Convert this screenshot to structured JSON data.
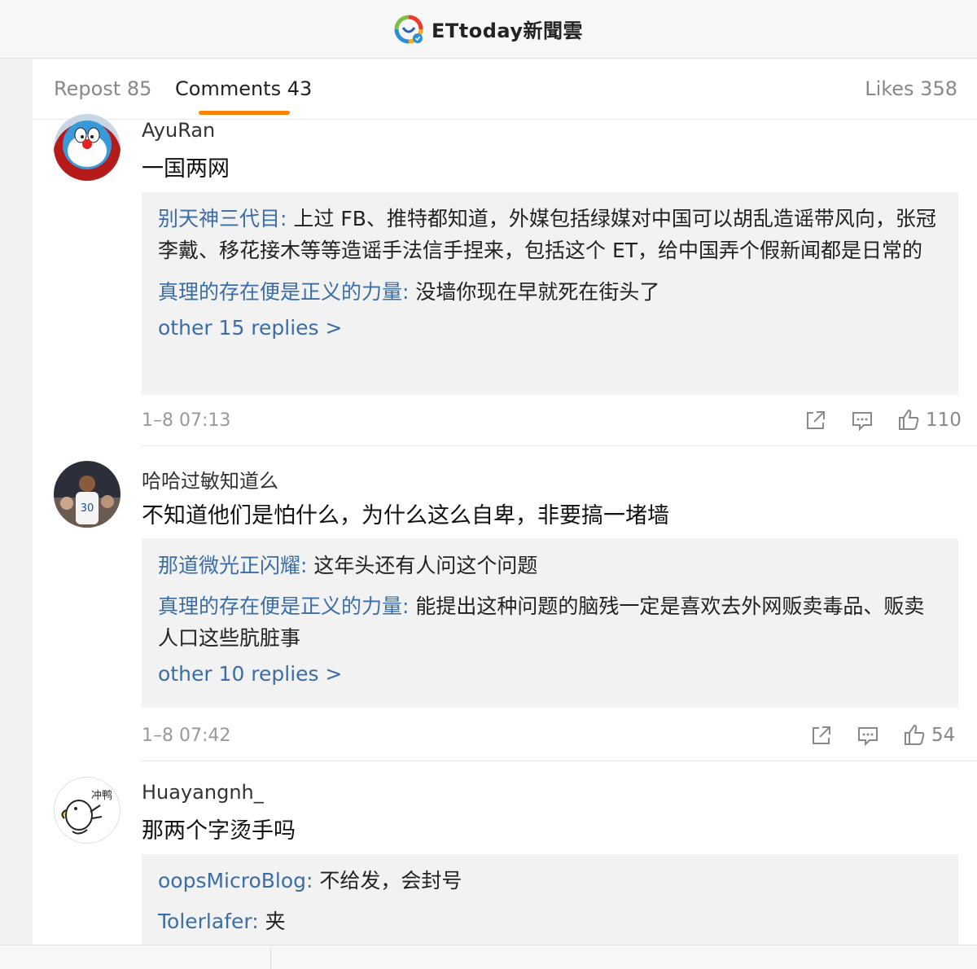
{
  "header": {
    "brand": "ETtoday新聞雲",
    "logo_icon": "ettoday-logo-icon",
    "verified_icon": "verified-badge-icon"
  },
  "tabs": {
    "repost": "Repost 85",
    "comments": "Comments 43",
    "likes": "Likes 358",
    "active": "comments",
    "accent_color": "#ff8200"
  },
  "comments": [
    {
      "user": "AyuRan",
      "avatar_icon": "doraemon-avatar",
      "text": "一国两网",
      "replies": [
        {
          "user": "别天神三代目",
          "sep": ": ",
          "text": "上过 FB、推特都知道，外媒包括绿媒对中国可以胡乱造谣带风向，张冠李戴、移花接木等等造谣手法信手捏来，包括这个 ET，给中国弄个假新闻都是日常的"
        },
        {
          "user": "真理的存在便是正义的力量",
          "sep": ": ",
          "text": "没墙你现在早就死在街头了"
        }
      ],
      "more": "other 15 replies >",
      "time": "1–8 07:13",
      "likes": "110"
    },
    {
      "user": "哈哈过敏知道么",
      "avatar_icon": "basketball-player-avatar",
      "text": "不知道他们是怕什么，为什么这么自卑，非要搞一堵墙",
      "replies": [
        {
          "user": "那道微光正闪耀",
          "sep": ": ",
          "text": "这年头还有人问这个问题"
        },
        {
          "user": "真理的存在便是正义的力量",
          "sep": ": ",
          "text": "能提出这种问题的脑残一定是喜欢去外网贩卖毒品、贩卖人口这些肮脏事"
        }
      ],
      "more": "other 10 replies >",
      "time": "1–8 07:42",
      "likes": "54"
    },
    {
      "user": "Huayangnh_",
      "avatar_icon": "duck-cartoon-avatar",
      "avatar_text": "冲鸭",
      "text": "那两个字烫手吗",
      "replies": [
        {
          "user": "oopsMicroBlog",
          "sep": ": ",
          "text": "不给发，会封号"
        },
        {
          "user": "Tolerlafer",
          "sep": ": ",
          "text": "夹"
        }
      ]
    }
  ],
  "icons": {
    "share": "share-icon",
    "comment": "comment-icon",
    "like": "thumbs-up-icon"
  },
  "colors": {
    "link": "#3b6ea5",
    "reply_bg": "#f2f2f2"
  }
}
